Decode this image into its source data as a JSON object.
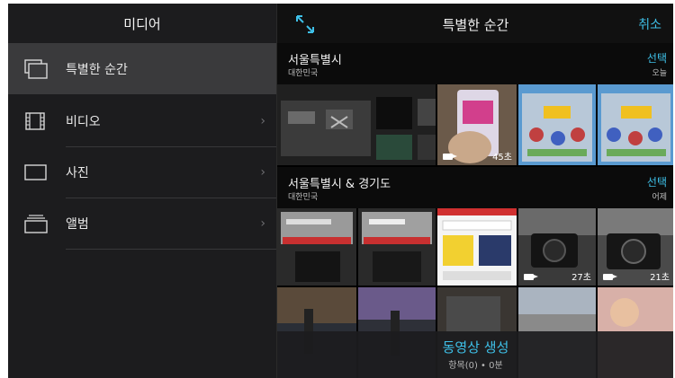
{
  "sidebar": {
    "title": "미디어",
    "items": [
      {
        "label": "특별한 순간",
        "icon": "moments-icon",
        "selected": true
      },
      {
        "label": "비디오",
        "icon": "film-icon",
        "chevron": "›"
      },
      {
        "label": "사진",
        "icon": "photo-icon",
        "chevron": "›"
      },
      {
        "label": "앨범",
        "icon": "album-icon",
        "chevron": "›"
      }
    ]
  },
  "topbar": {
    "title": "특별한 순간",
    "cancel_label": "취소",
    "expand_icon": "expand-icon"
  },
  "sections": [
    {
      "place": "서울특별시",
      "country": "대한민국",
      "select_label": "선택",
      "date": "오늘"
    },
    {
      "place": "서울특별시 & 경기도",
      "country": "대한민국",
      "select_label": "선택",
      "date": "어제"
    }
  ],
  "thumbnails": {
    "row1_durations": [
      "45초"
    ],
    "row2_durations": [
      "27초",
      "21초"
    ]
  },
  "bottom": {
    "create_label": "동영상 생성",
    "count_label": "항목(0) • 0분"
  },
  "colors": {
    "accent": "#3ec0e8",
    "background": "#000000",
    "sidebar": "#1c1c1e",
    "selected_row": "#3a3a3c"
  }
}
